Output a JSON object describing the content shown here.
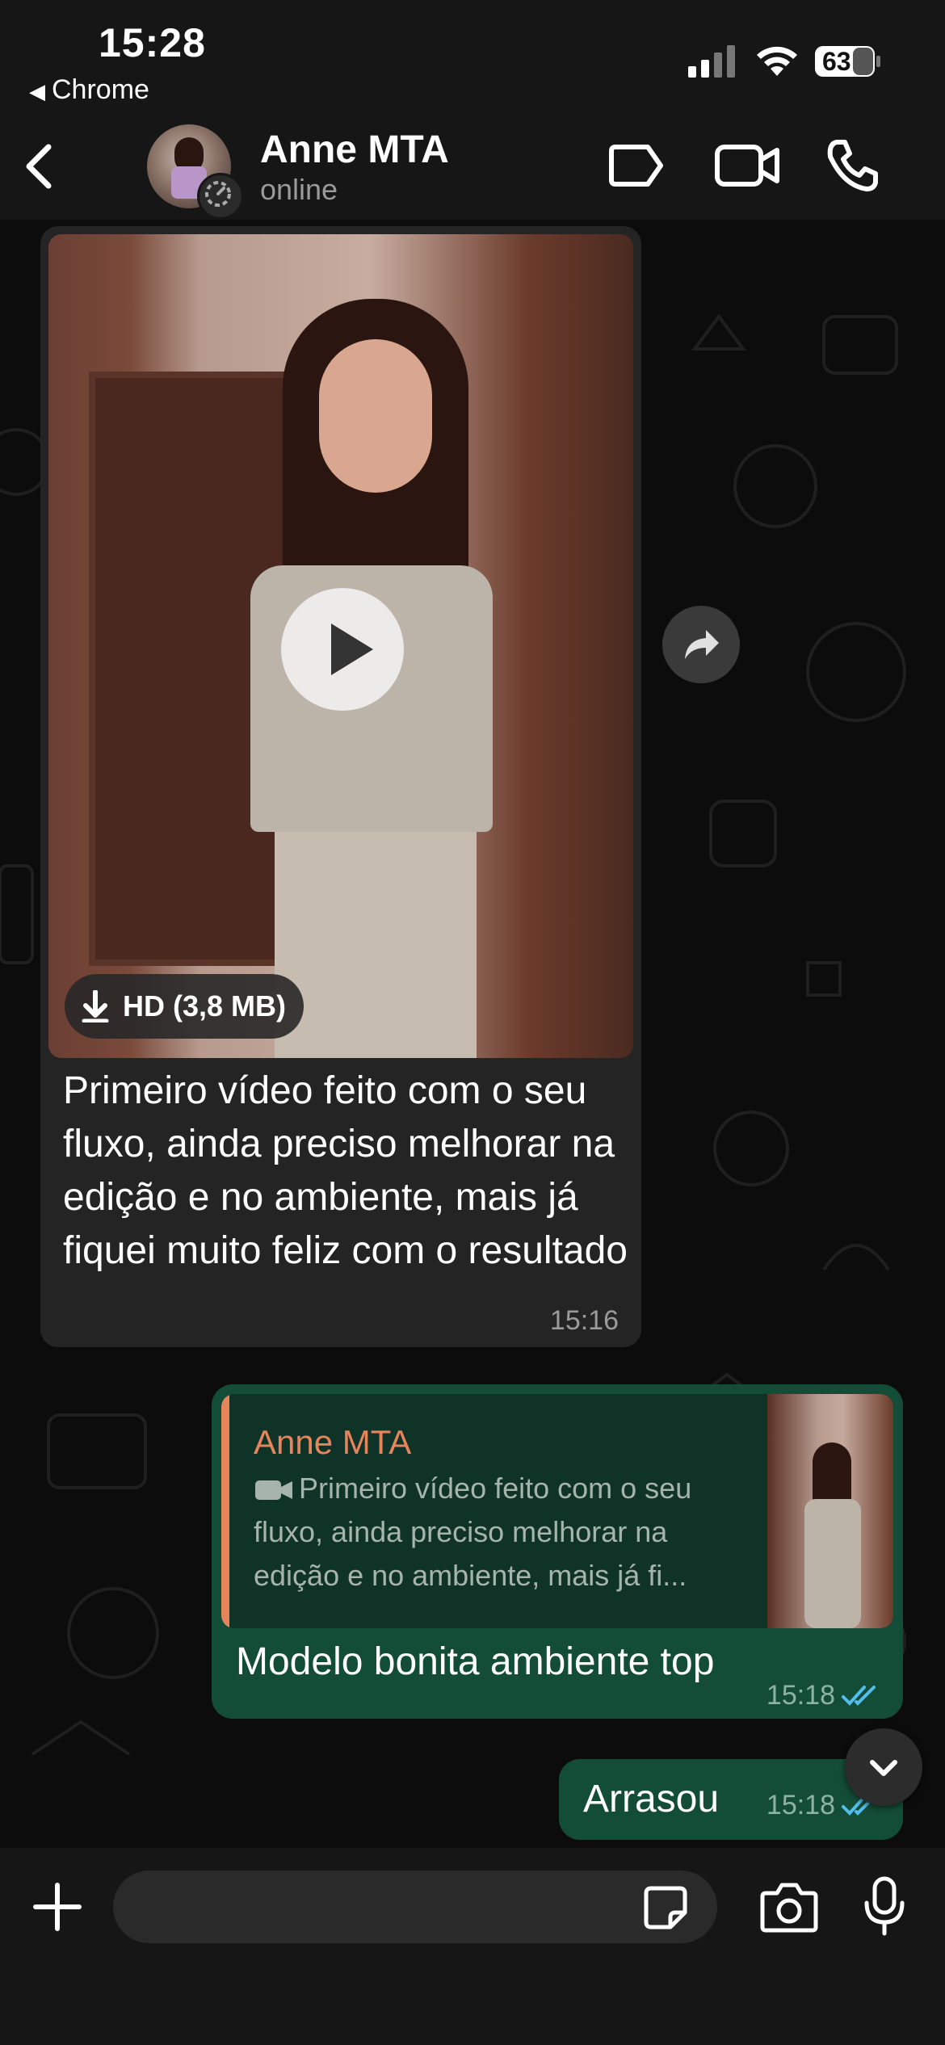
{
  "status_bar": {
    "time": "15:28",
    "back_app": "Chrome",
    "battery": "63"
  },
  "header": {
    "contact_name": "Anne MTA",
    "contact_status": "online"
  },
  "messages": {
    "incoming_video": {
      "download_label": "HD (3,8 MB)",
      "caption": "Primeiro vídeo feito com o seu fluxo, ainda preciso melhorar na edição e no ambiente, mais já fiquei muito feliz com o resultado",
      "time": "15:16"
    },
    "reply": {
      "quote_name": "Anne MTA",
      "quote_text": "Primeiro vídeo feito com o seu fluxo, ainda preciso melhorar na edição e no ambiente, mais já fi...",
      "text": "Modelo bonita ambiente top",
      "time": "15:18"
    },
    "short": {
      "text": "Arrasou",
      "time": "15:18"
    }
  },
  "composer": {
    "placeholder": ""
  },
  "colors": {
    "outgoing_bubble": "#144d37",
    "incoming_bubble": "#242424",
    "quote_accent": "#e6845c",
    "read_ticks": "#53bdeb"
  }
}
